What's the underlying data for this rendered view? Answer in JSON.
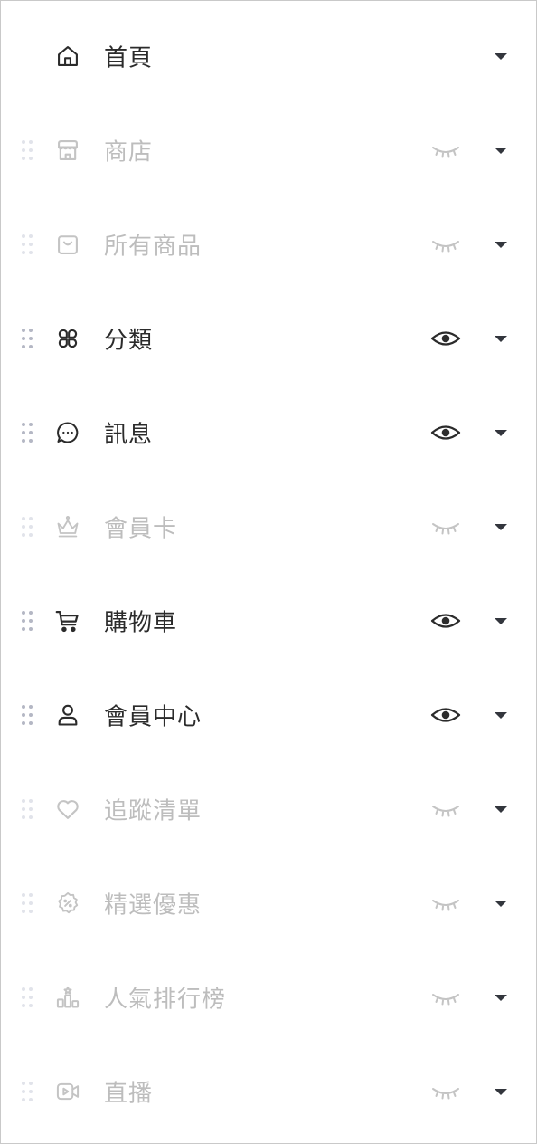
{
  "menu": {
    "items": [
      {
        "label": "首頁",
        "icon": "home-icon",
        "visible": true,
        "draggable": false
      },
      {
        "label": "商店",
        "icon": "store-icon",
        "visible": false,
        "draggable": true
      },
      {
        "label": "所有商品",
        "icon": "bag-icon",
        "visible": false,
        "draggable": true
      },
      {
        "label": "分類",
        "icon": "category-grid-icon",
        "visible": true,
        "draggable": true
      },
      {
        "label": "訊息",
        "icon": "chat-bubble-icon",
        "visible": true,
        "draggable": true
      },
      {
        "label": "會員卡",
        "icon": "crown-icon",
        "visible": false,
        "draggable": true
      },
      {
        "label": "購物車",
        "icon": "cart-icon",
        "visible": true,
        "draggable": true
      },
      {
        "label": "會員中心",
        "icon": "user-icon",
        "visible": true,
        "draggable": true
      },
      {
        "label": "追蹤清單",
        "icon": "heart-icon",
        "visible": false,
        "draggable": true
      },
      {
        "label": "精選優惠",
        "icon": "discount-badge-icon",
        "visible": false,
        "draggable": true
      },
      {
        "label": "人氣排行榜",
        "icon": "ranking-podium-icon",
        "visible": false,
        "draggable": true
      },
      {
        "label": "直播",
        "icon": "video-camera-icon",
        "visible": false,
        "draggable": true
      }
    ]
  },
  "colors": {
    "text_active": "#2b2b2b",
    "text_inactive": "#bdbdbd",
    "drag_active": "#b4b7c4",
    "drag_inactive": "#e1e3ea",
    "caret": "#33363d",
    "border": "#c9c9c9"
  }
}
